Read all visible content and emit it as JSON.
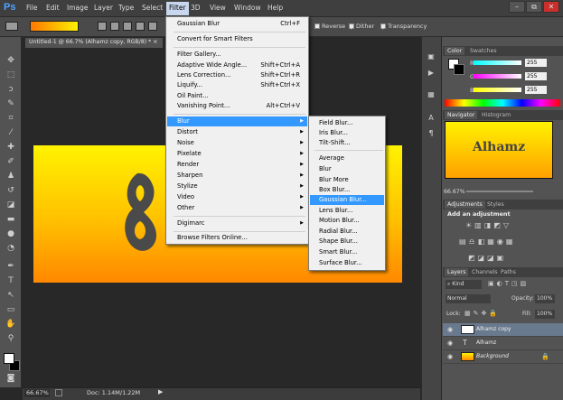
{
  "app": {
    "logo": "Ps"
  },
  "menubar": [
    "File",
    "Edit",
    "Image",
    "Layer",
    "Type",
    "Select",
    "Filter",
    "3D",
    "View",
    "Window",
    "Help"
  ],
  "window_controls": {
    "minimize": "–",
    "maximize": "⧉",
    "close": "✕"
  },
  "options": {
    "reverse": "Reverse",
    "dither": "Dither",
    "transparency": "Transparency"
  },
  "document": {
    "tab_title": "Untitled-1 @ 66.7% (Alhamz copy, RGB/8) *",
    "tab_close": "×"
  },
  "status": {
    "zoom": "66.67%",
    "doc_info": "Doc: 1.14M/1.22M"
  },
  "filter_menu": {
    "items": [
      {
        "label": "Gaussian Blur",
        "shortcut": "Ctrl+F"
      },
      {
        "label": "Convert for Smart Filters",
        "shortcut": ""
      },
      {
        "label": "Filter Gallery...",
        "shortcut": ""
      },
      {
        "label": "Adaptive Wide Angle...",
        "shortcut": "Shift+Ctrl+A"
      },
      {
        "label": "Lens Correction...",
        "shortcut": "Shift+Ctrl+R"
      },
      {
        "label": "Liquify...",
        "shortcut": "Shift+Ctrl+X"
      },
      {
        "label": "Oil Paint...",
        "shortcut": ""
      },
      {
        "label": "Vanishing Point...",
        "shortcut": "Alt+Ctrl+V"
      },
      {
        "label": "Blur",
        "shortcut": ""
      },
      {
        "label": "Distort",
        "shortcut": ""
      },
      {
        "label": "Noise",
        "shortcut": ""
      },
      {
        "label": "Pixelate",
        "shortcut": ""
      },
      {
        "label": "Render",
        "shortcut": ""
      },
      {
        "label": "Sharpen",
        "shortcut": ""
      },
      {
        "label": "Stylize",
        "shortcut": ""
      },
      {
        "label": "Video",
        "shortcut": ""
      },
      {
        "label": "Other",
        "shortcut": ""
      },
      {
        "label": "Digimarc",
        "shortcut": ""
      },
      {
        "label": "Browse Filters Online...",
        "shortcut": ""
      }
    ]
  },
  "blur_submenu": {
    "items": [
      "Field Blur...",
      "Iris Blur...",
      "Tilt-Shift...",
      "Average",
      "Blur",
      "Blur More",
      "Box Blur...",
      "Gaussian Blur...",
      "Lens Blur...",
      "Motion Blur...",
      "Radial Blur...",
      "Shape Blur...",
      "Smart Blur...",
      "Surface Blur..."
    ]
  },
  "color_panel": {
    "tabs": [
      "Color",
      "Swatches"
    ],
    "channels": [
      {
        "label": "R",
        "value": "255"
      },
      {
        "label": "G",
        "value": "255"
      },
      {
        "label": "B",
        "value": "255"
      }
    ]
  },
  "navigator_panel": {
    "tabs": [
      "Navigator",
      "Histogram"
    ],
    "zoom": "66.67%",
    "thumb_text": "Alhamz"
  },
  "adjustments_panel": {
    "tabs": [
      "Adjustments",
      "Styles"
    ],
    "heading": "Add an adjustment"
  },
  "layers_panel": {
    "tabs": [
      "Layers",
      "Channels",
      "Paths"
    ],
    "kind": "Kind",
    "blend_mode": "Normal",
    "opacity_label": "Opacity:",
    "opacity": "100%",
    "lock_label": "Lock:",
    "fill_label": "Fill:",
    "fill": "100%",
    "layers": [
      {
        "name": "Alhamz copy",
        "type": "image"
      },
      {
        "name": "Alhamz",
        "type": "text"
      },
      {
        "name": "Background",
        "type": "image"
      }
    ]
  },
  "colors": {
    "accent": "#3399ff",
    "grad_start": "#ff7800",
    "grad_end": "#fff200"
  }
}
